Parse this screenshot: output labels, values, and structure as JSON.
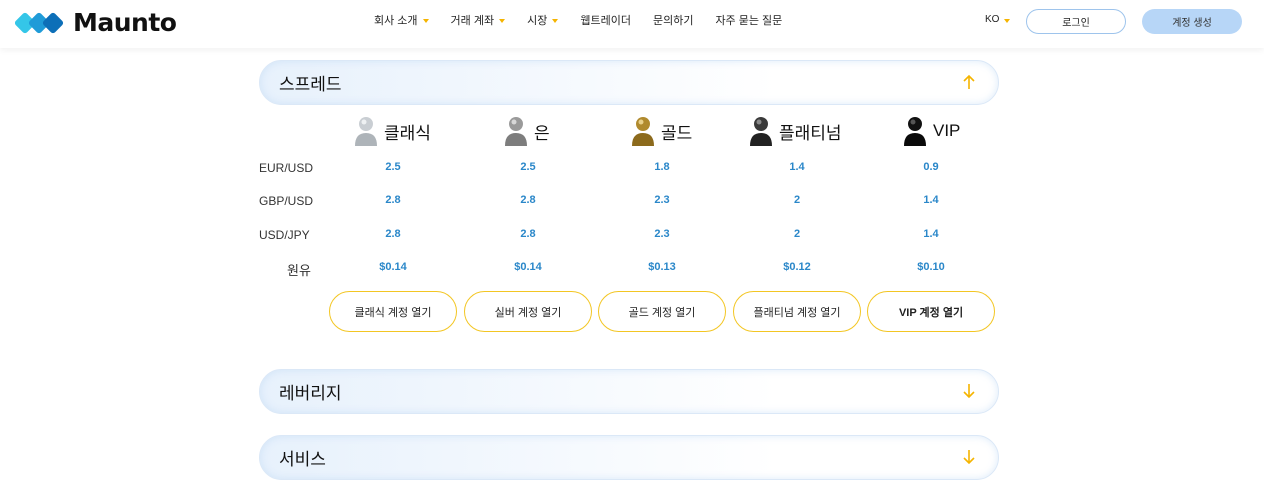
{
  "header": {
    "logo_text": "Maunto",
    "nav": [
      {
        "label": "회사 소개",
        "has_caret": true
      },
      {
        "label": "거래 계좌",
        "has_caret": true
      },
      {
        "label": "시장",
        "has_caret": true
      },
      {
        "label": "웹트레이더",
        "has_caret": false
      },
      {
        "label": "문의하기",
        "has_caret": false
      },
      {
        "label": "자주 묻는 질문",
        "has_caret": false
      }
    ],
    "lang": "KO",
    "login_label": "로그인",
    "signup_label": "계정 생성"
  },
  "sections": {
    "spread": {
      "title": "스프레드",
      "state": "expanded"
    },
    "leverage": {
      "title": "레버리지",
      "state": "collapsed"
    },
    "services": {
      "title": "서비스",
      "state": "collapsed"
    }
  },
  "tiers": [
    {
      "name": "클래식",
      "icon": "classic-user-icon",
      "color": "#c9ced3"
    },
    {
      "name": "은",
      "icon": "silver-user-icon",
      "color": "#9a9a9a"
    },
    {
      "name": "골드",
      "icon": "gold-user-icon",
      "color": "#b08a2e"
    },
    {
      "name": "플래티넘",
      "icon": "platinum-user-icon",
      "color": "#3a3a3a"
    },
    {
      "name": "VIP",
      "icon": "vip-user-icon",
      "color": "#111111"
    }
  ],
  "spread_rows": [
    {
      "label": "EUR/USD",
      "values": [
        "2.5",
        "2.5",
        "1.8",
        "1.4",
        "0.9"
      ]
    },
    {
      "label": "GBP/USD",
      "values": [
        "2.8",
        "2.8",
        "2.3",
        "2",
        "1.4"
      ]
    },
    {
      "label": "USD/JPY",
      "values": [
        "2.8",
        "2.8",
        "2.3",
        "2",
        "1.4"
      ]
    },
    {
      "label": "원유",
      "values": [
        "$0.14",
        "$0.14",
        "$0.13",
        "$0.12",
        "$0.10"
      ]
    }
  ],
  "open_buttons": [
    "클래식 계정 열기",
    "실버 계정 열기",
    "골드 계정 열기",
    "플래티넘 계정 열기",
    "VIP 계정 열기"
  ],
  "colors": {
    "accent": "#f5b400",
    "value_blue": "#2a87c9",
    "logo_blue": "#1f9bd8"
  }
}
